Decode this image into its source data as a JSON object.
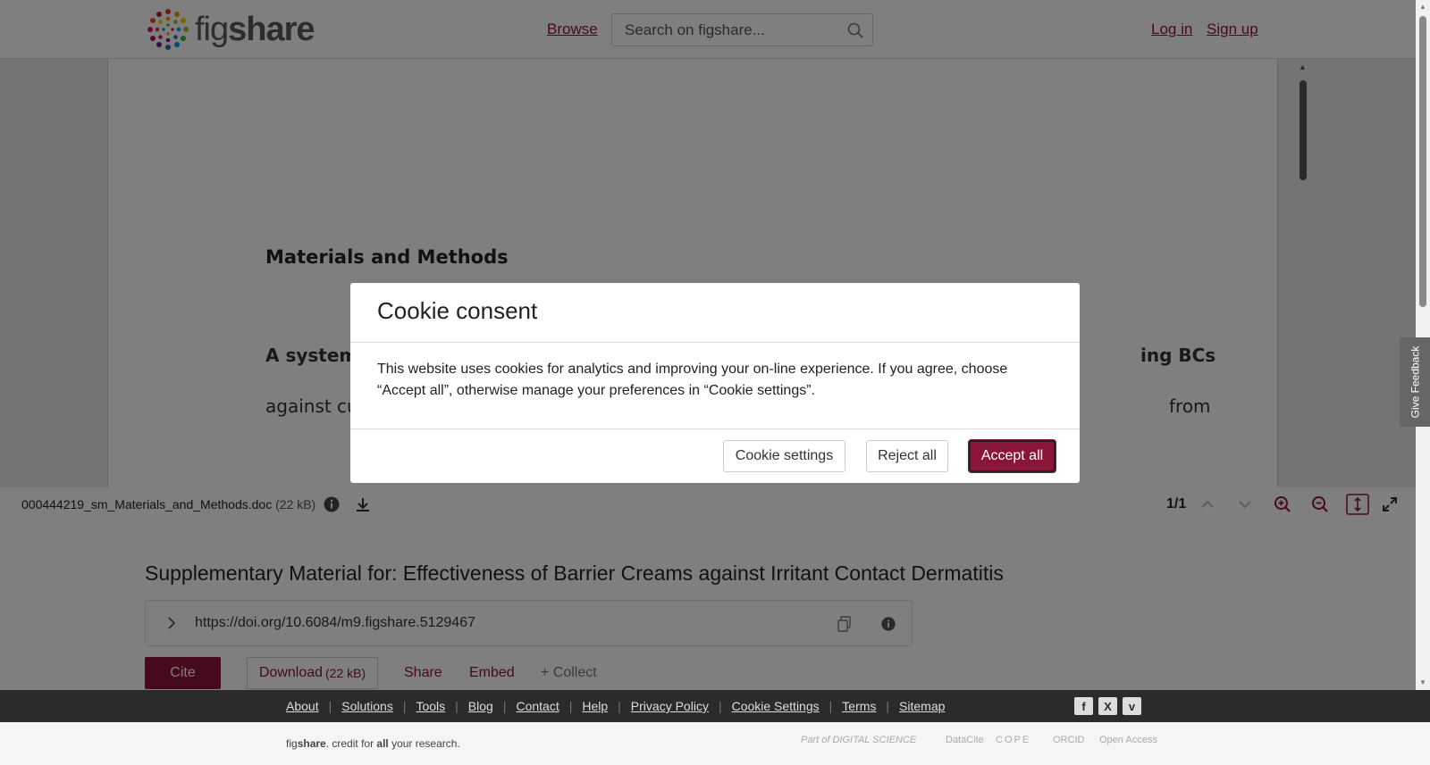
{
  "header": {
    "logo_part1": "fig",
    "logo_part2": "share",
    "browse": "Browse",
    "search_placeholder": "Search on figshare...",
    "login": "Log in",
    "signup": "Sign up"
  },
  "viewer": {
    "doc_heading": "Materials and Methods",
    "doc_line1_left": "A systema",
    "doc_line1_right": "ing BCs",
    "doc_line2_left": "against cu",
    "doc_line2_right": "from"
  },
  "toolbar": {
    "filename": "000444219_sm_Materials_and_Methods.doc",
    "filesize": "(22 kB)",
    "page_indicator": "1/1"
  },
  "article": {
    "title": "Supplementary Material for: Effectiveness of Barrier Creams against Irritant Contact Dermatitis",
    "doi": "https://doi.org/10.6084/m9.figshare.5129467",
    "cite": "Cite",
    "download": "Download",
    "download_size": "(22 kB)",
    "share": "Share",
    "embed": "Embed",
    "collect": "+ Collect"
  },
  "footer": {
    "links": [
      "About",
      "Solutions",
      "Tools",
      "Blog",
      "Contact",
      "Help",
      "Privacy Policy",
      "Cookie Settings",
      "Terms",
      "Sitemap"
    ],
    "social": [
      "f",
      "X",
      "v"
    ],
    "tagline_fig": "fig",
    "tagline_share": "share",
    "tagline_mid": ". credit for ",
    "tagline_all": "all",
    "tagline_end": " your research.",
    "partners": [
      "Part of DIGITAL SCIENCE",
      "DataCite",
      "COPE",
      "ORCID",
      "Open Access"
    ]
  },
  "feedback": "Give Feedback",
  "cookie_modal": {
    "title": "Cookie consent",
    "body": "This website uses cookies for analytics and improving your on-line experience. If you agree, choose “Accept all”, otherwise manage your preferences in “Cookie settings”.",
    "settings": "Cookie settings",
    "reject": "Reject all",
    "accept": "Accept all"
  },
  "colors": {
    "brand": "#8a1538",
    "footer_dark": "#2b2b2b"
  }
}
